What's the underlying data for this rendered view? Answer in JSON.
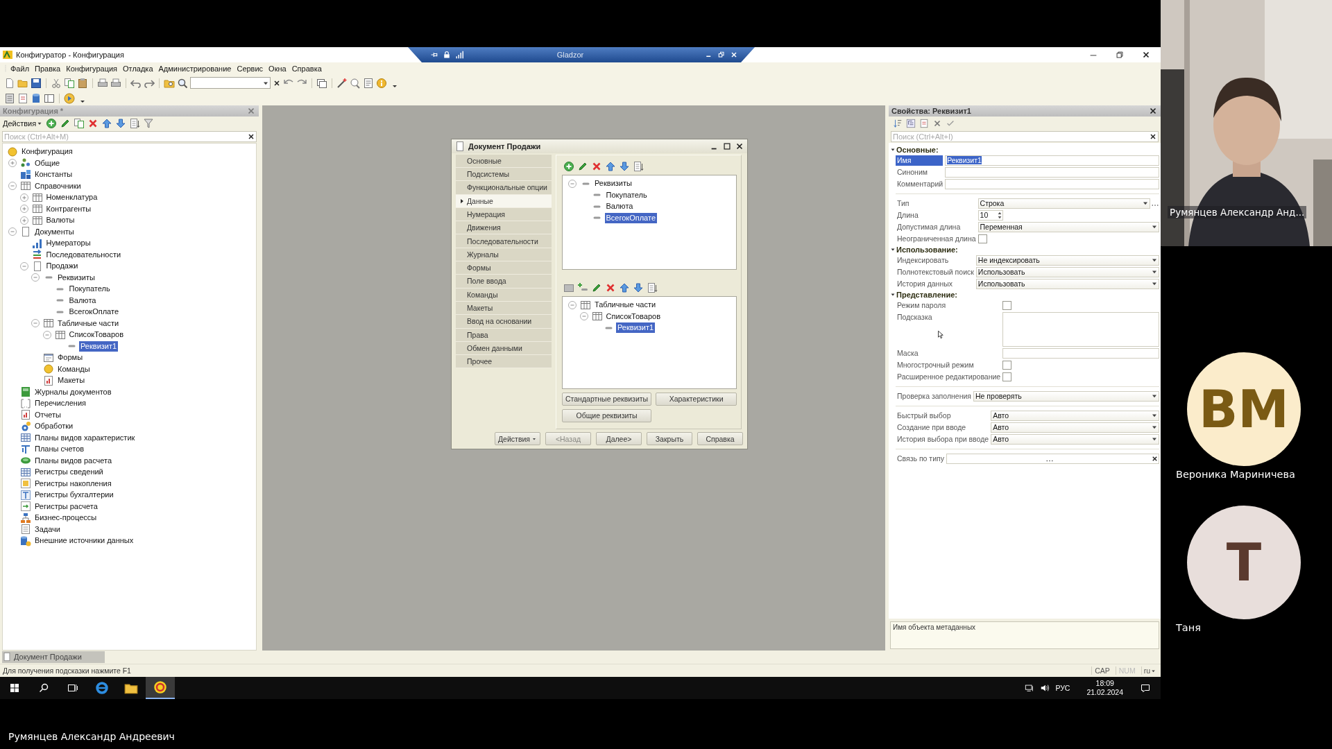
{
  "title_bar": {
    "title": "Конфигуратор - Конфигурация"
  },
  "remote_bar": {
    "title": "Gladzor"
  },
  "menu": [
    "Файл",
    "Правка",
    "Конфигурация",
    "Отладка",
    "Администрирование",
    "Сервис",
    "Окна",
    "Справка"
  ],
  "config_panel": {
    "title": "Конфигурация *",
    "actions": "Действия",
    "search": {
      "placeholder": "Поиск (Ctrl+Alt+M)"
    },
    "tree": [
      {
        "label": "Конфигурация",
        "kind": "disc",
        "selected": false,
        "children": [
          {
            "label": "Общие",
            "kind": "dots",
            "selected": false,
            "expanded": false
          },
          {
            "label": "Константы",
            "kind": "blocks",
            "selected": false
          },
          {
            "label": "Справочники",
            "kind": "table",
            "selected": false,
            "expanded": true,
            "children": [
              {
                "label": "Номенклатура",
                "kind": "table",
                "selected": false,
                "expanded": false
              },
              {
                "label": "Контрагенты",
                "kind": "table",
                "selected": false,
                "expanded": false
              },
              {
                "label": "Валюты",
                "kind": "table",
                "selected": false,
                "expanded": false
              }
            ]
          },
          {
            "label": "Документы",
            "kind": "page",
            "selected": false,
            "expanded": true,
            "children": [
              {
                "label": "Нумераторы",
                "kind": "steps",
                "selected": false
              },
              {
                "label": "Последовательности",
                "kind": "arrows",
                "selected": false
              },
              {
                "label": "Продажи",
                "kind": "page",
                "selected": false,
                "expanded": true,
                "children": [
                  {
                    "label": "Реквизиты",
                    "kind": "dash",
                    "selected": false,
                    "expanded": true,
                    "children": [
                      {
                        "label": "Покупатель",
                        "kind": "dash",
                        "selected": false
                      },
                      {
                        "label": "Валюта",
                        "kind": "dash",
                        "selected": false
                      },
                      {
                        "label": "ВсегокОплате",
                        "kind": "dash",
                        "selected": false
                      }
                    ]
                  },
                  {
                    "label": "Табличные части",
                    "kind": "table",
                    "selected": false,
                    "expanded": true,
                    "children": [
                      {
                        "label": "СписокТоваров",
                        "kind": "table",
                        "selected": false,
                        "expanded": true,
                        "children": [
                          {
                            "label": "Реквизит1",
                            "kind": "dash",
                            "selected": true
                          }
                        ]
                      }
                    ]
                  },
                  {
                    "label": "Формы",
                    "kind": "form",
                    "selected": false
                  },
                  {
                    "label": "Команды",
                    "kind": "disc",
                    "selected": false
                  },
                  {
                    "label": "Макеты",
                    "kind": "chart",
                    "selected": false
                  }
                ]
              }
            ]
          },
          {
            "label": "Журналы документов",
            "kind": "book",
            "selected": false
          },
          {
            "label": "Перечисления",
            "kind": "bracket",
            "selected": false
          },
          {
            "label": "Отчеты",
            "kind": "chart",
            "selected": false
          },
          {
            "label": "Обработки",
            "kind": "gear",
            "selected": false
          },
          {
            "label": "Планы видов характеристик",
            "kind": "grid",
            "selected": false
          },
          {
            "label": "Планы счетов",
            "kind": "tee",
            "selected": false
          },
          {
            "label": "Планы видов расчета",
            "kind": "puck",
            "selected": false
          },
          {
            "label": "Регистры сведений",
            "kind": "grid",
            "selected": false
          },
          {
            "label": "Регистры накопления",
            "kind": "square",
            "selected": false
          },
          {
            "label": "Регистры бухгалтерии",
            "kind": "boxtee",
            "selected": false
          },
          {
            "label": "Регистры расчета",
            "kind": "boxarrow",
            "selected": false
          },
          {
            "label": "Бизнес-процессы",
            "kind": "flow",
            "selected": false
          },
          {
            "label": "Задачи",
            "kind": "list",
            "selected": false
          },
          {
            "label": "Внешние источники данных",
            "kind": "database",
            "selected": false
          }
        ]
      }
    ]
  },
  "dialog": {
    "title": "Документ Продажи",
    "sections": [
      {
        "label": "Основные",
        "selected": false
      },
      {
        "label": "Подсистемы",
        "selected": false
      },
      {
        "label": "Функциональные опции",
        "selected": false
      },
      {
        "label": "Данные",
        "selected": true
      },
      {
        "label": "Нумерация",
        "selected": false
      },
      {
        "label": "Движения",
        "selected": false
      },
      {
        "label": "Последовательности",
        "selected": false
      },
      {
        "label": "Журналы",
        "selected": false
      },
      {
        "label": "Формы",
        "selected": false
      },
      {
        "label": "Поле ввода",
        "selected": false
      },
      {
        "label": "Команды",
        "selected": false
      },
      {
        "label": "Макеты",
        "selected": false
      },
      {
        "label": "Ввод на основании",
        "selected": false
      },
      {
        "label": "Права",
        "selected": false
      },
      {
        "label": "Обмен данными",
        "selected": false
      },
      {
        "label": "Прочее",
        "selected": false
      }
    ],
    "attributes_tree": [
      {
        "label": "Реквизиты",
        "kind": "dash",
        "selected": false,
        "expanded": true,
        "children": [
          {
            "label": "Покупатель",
            "kind": "dash",
            "selected": false
          },
          {
            "label": "Валюта",
            "kind": "dash",
            "selected": false
          },
          {
            "label": "ВсегокОплате",
            "kind": "dash",
            "selected": true
          }
        ]
      }
    ],
    "tabular_tree": [
      {
        "label": "Табличные части",
        "kind": "table",
        "selected": false,
        "expanded": true,
        "children": [
          {
            "label": "СписокТоваров",
            "kind": "table",
            "selected": false,
            "expanded": true,
            "children": [
              {
                "label": "Реквизит1",
                "kind": "dash",
                "selected": true
              }
            ]
          }
        ]
      }
    ],
    "buttons": [
      "Стандартные реквизиты",
      "Характеристики",
      "Общие реквизиты"
    ],
    "footer_buttons": [
      {
        "label": "Действия",
        "kind": "menu",
        "disabled": false
      },
      {
        "label": "<Назад",
        "kind": "button",
        "disabled": true
      },
      {
        "label": "Далее>",
        "kind": "button",
        "disabled": false
      },
      {
        "label": "Закрыть",
        "kind": "button",
        "disabled": false
      },
      {
        "label": "Справка",
        "kind": "button",
        "disabled": false
      }
    ]
  },
  "properties": {
    "title": "Свойства: Реквизит1",
    "search": {
      "placeholder": "Поиск (Ctrl+Alt+I)"
    },
    "groups": [
      {
        "title": "Основные:",
        "expanded": true,
        "blocks": [
          [
            {
              "label": "Имя",
              "kind": "text",
              "value": "Реквизит1",
              "selected": true
            },
            {
              "label": "Синоним",
              "kind": "text",
              "selected": false
            },
            {
              "label": "Комментарий",
              "kind": "text",
              "selected": false
            }
          ],
          [
            {
              "label": "Тип",
              "kind": "type",
              "value": "Строка",
              "selected": false
            },
            {
              "label": "Длина",
              "kind": "number",
              "value": "10",
              "selected": false
            },
            {
              "label": "Допустимая длина",
              "kind": "select",
              "value": "Переменная",
              "selected": false
            },
            {
              "label": "Неограниченная длина",
              "kind": "checkbox",
              "checked": false,
              "selected": false
            }
          ]
        ]
      },
      {
        "title": "Использование:",
        "expanded": true,
        "blocks": [
          [
            {
              "label": "Индексировать",
              "kind": "select",
              "value": "Не индексировать",
              "selected": false
            },
            {
              "label": "Полнотекстовый поиск",
              "kind": "select",
              "value": "Использовать",
              "selected": false
            },
            {
              "label": "История данных",
              "kind": "select",
              "value": "Использовать",
              "selected": false
            }
          ]
        ]
      },
      {
        "title": "Представление:",
        "expanded": true,
        "blocks": [
          [
            {
              "label": "Режим пароля",
              "kind": "checkbox",
              "checked": false,
              "selected": false
            },
            {
              "label": "Подсказка",
              "kind": "textarea",
              "selected": false
            },
            {
              "label": "Маска",
              "kind": "text",
              "selected": false
            },
            {
              "label": "Многострочный режим",
              "kind": "checkbox",
              "checked": false,
              "selected": false
            },
            {
              "label": "Расширенное редактирование",
              "kind": "checkbox",
              "checked": false,
              "selected": false
            }
          ],
          [
            {
              "label": "Проверка заполнения",
              "kind": "select",
              "value": "Не проверять",
              "selected": false
            }
          ],
          [
            {
              "label": "Быстрый выбор",
              "kind": "select",
              "value": "Авто",
              "selected": false
            },
            {
              "label": "Создание при вводе",
              "kind": "select",
              "value": "Авто",
              "selected": false
            },
            {
              "label": "История выбора при вводе",
              "kind": "select",
              "value": "Авто",
              "selected": false
            }
          ],
          [
            {
              "label": "Связь по типу",
              "kind": "choice",
              "selected": false
            }
          ]
        ]
      }
    ],
    "description": "Имя объекта метаданных"
  },
  "window_tabs": [
    {
      "label": "Документ Продажи"
    }
  ],
  "status_bar": {
    "hint": "Для получения подсказки нажмите F1",
    "indicators": [
      {
        "label": "CAP",
        "on": true
      },
      {
        "label": "NUM",
        "on": false
      }
    ],
    "language": "ru"
  },
  "taskbar": {
    "apps": [
      {
        "kind": "browser",
        "active": false
      },
      {
        "kind": "folder",
        "active": false
      },
      {
        "kind": "onec",
        "active": true
      }
    ],
    "language": "РУС",
    "time": "18:09",
    "date": "21.02.2024"
  },
  "participants": [
    {
      "kind": "video",
      "name": "Румянцев Александр Анд..."
    },
    {
      "kind": "avatar",
      "name": "Вероника Мариничева",
      "initials": "ВМ",
      "color": "#fbeccb"
    },
    {
      "kind": "avatar",
      "name": "Таня",
      "initials": "Т",
      "color": "#e8dedb"
    }
  ],
  "presenter_caption": "Румянцев Александр Андреевич"
}
